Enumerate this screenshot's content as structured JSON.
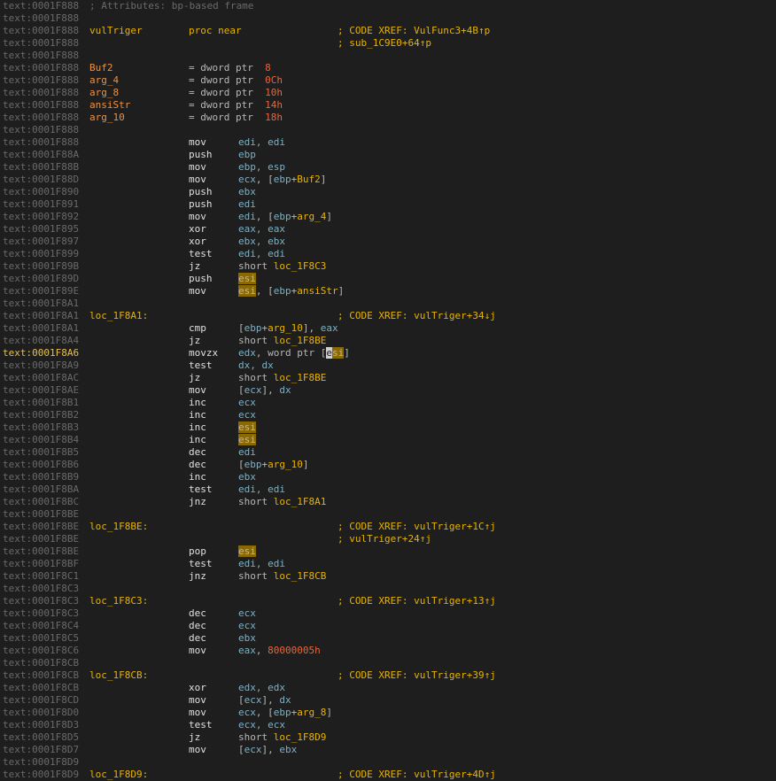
{
  "header_comment": "; Attributes: bp-based frame",
  "proc": {
    "name": "vulTriger",
    "decl": "proc near",
    "xrefs": [
      "; CODE XREF: VulFunc3+4B↑p",
      "; sub_1C9E0+64↑p"
    ]
  },
  "vars": [
    {
      "name": "Buf2",
      "def": "= dword ptr",
      "off": "8"
    },
    {
      "name": "arg_4",
      "def": "= dword ptr",
      "off": "0Ch"
    },
    {
      "name": "arg_8",
      "def": "= dword ptr",
      "off": "10h"
    },
    {
      "name": "ansiStr",
      "def": "= dword ptr",
      "off": "14h"
    },
    {
      "name": "arg_10",
      "def": "= dword ptr",
      "off": "18h"
    }
  ],
  "addresses": [
    "text:0001F888",
    "text:0001F888",
    "text:0001F888",
    "text:0001F888",
    "text:0001F888",
    "text:0001F888",
    "text:0001F888",
    "text:0001F888",
    "text:0001F888",
    "text:0001F888",
    "text:0001F888",
    "text:0001F888",
    "text:0001F88A",
    "text:0001F88B",
    "text:0001F88D",
    "text:0001F890",
    "text:0001F891",
    "text:0001F892",
    "text:0001F895",
    "text:0001F897",
    "text:0001F899",
    "text:0001F89B",
    "text:0001F89D",
    "text:0001F89E",
    "text:0001F8A1",
    "text:0001F8A1",
    "text:0001F8A1",
    "text:0001F8A4",
    "text:0001F8A6",
    "text:0001F8A9",
    "text:0001F8AC",
    "text:0001F8AE",
    "text:0001F8B1",
    "text:0001F8B2",
    "text:0001F8B3",
    "text:0001F8B4",
    "text:0001F8B5",
    "text:0001F8B6",
    "text:0001F8B9",
    "text:0001F8BA",
    "text:0001F8BC",
    "text:0001F8BE",
    "text:0001F8BE",
    "text:0001F8BE",
    "text:0001F8BE",
    "text:0001F8BF",
    "text:0001F8C1",
    "text:0001F8C3",
    "text:0001F8C3",
    "text:0001F8C3",
    "text:0001F8C4",
    "text:0001F8C5",
    "text:0001F8C6",
    "text:0001F8CB",
    "text:0001F8CB",
    "text:0001F8CB",
    "text:0001F8CD",
    "text:0001F8D0",
    "text:0001F8D3",
    "text:0001F8D5",
    "text:0001F8D7",
    "text:0001F8D9",
    "text:0001F8D9"
  ],
  "labels": {
    "loc_1F8A1": {
      "name": "loc_1F8A1:",
      "xref": "; CODE XREF: vulTriger+34↓j"
    },
    "loc_1F8BE": {
      "name": "loc_1F8BE:",
      "xref": "; CODE XREF: vulTriger+1C↑j",
      "xref2": "; vulTriger+24↑j"
    },
    "loc_1F8C3": {
      "name": "loc_1F8C3:",
      "xref": "; CODE XREF: vulTriger+13↑j"
    },
    "loc_1F8CB": {
      "name": "loc_1F8CB:",
      "xref": "; CODE XREF: vulTriger+39↑j"
    },
    "loc_1F8D9": {
      "name": "loc_1F8D9:",
      "xref": "; CODE XREF: vulTriger+4D↑j"
    }
  },
  "instructions": [
    {
      "m": "mov",
      "o": "edi, edi"
    },
    {
      "m": "push",
      "o": "ebp"
    },
    {
      "m": "mov",
      "o": "ebp, esp"
    },
    {
      "m": "mov",
      "o": "ecx, [ebp+Buf2]"
    },
    {
      "m": "push",
      "o": "ebx"
    },
    {
      "m": "push",
      "o": "edi"
    },
    {
      "m": "mov",
      "o": "edi, [ebp+arg_4]"
    },
    {
      "m": "xor",
      "o": "eax, eax"
    },
    {
      "m": "xor",
      "o": "ebx, ebx"
    },
    {
      "m": "test",
      "o": "edi, edi"
    },
    {
      "m": "jz",
      "o": "short loc_1F8C3"
    },
    {
      "m": "push",
      "o": "esi"
    },
    {
      "m": "mov",
      "o": "esi, [ebp+ansiStr]"
    },
    {
      "m": "cmp",
      "o": "[ebp+arg_10], eax"
    },
    {
      "m": "jz",
      "o": "short loc_1F8BE"
    },
    {
      "m": "movzx",
      "o": "edx, word ptr [esi]"
    },
    {
      "m": "test",
      "o": "dx, dx"
    },
    {
      "m": "jz",
      "o": "short loc_1F8BE"
    },
    {
      "m": "mov",
      "o": "[ecx], dx"
    },
    {
      "m": "inc",
      "o": "ecx"
    },
    {
      "m": "inc",
      "o": "ecx"
    },
    {
      "m": "inc",
      "o": "esi"
    },
    {
      "m": "inc",
      "o": "esi"
    },
    {
      "m": "dec",
      "o": "edi"
    },
    {
      "m": "dec",
      "o": "[ebp+arg_10]"
    },
    {
      "m": "inc",
      "o": "ebx"
    },
    {
      "m": "test",
      "o": "edi, edi"
    },
    {
      "m": "jnz",
      "o": "short loc_1F8A1"
    },
    {
      "m": "pop",
      "o": "esi"
    },
    {
      "m": "test",
      "o": "edi, edi"
    },
    {
      "m": "jnz",
      "o": "short loc_1F8CB"
    },
    {
      "m": "dec",
      "o": "ecx"
    },
    {
      "m": "dec",
      "o": "ecx"
    },
    {
      "m": "dec",
      "o": "ebx"
    },
    {
      "m": "mov",
      "o": "eax, 80000005h"
    },
    {
      "m": "xor",
      "o": "edx, edx"
    },
    {
      "m": "mov",
      "o": "[ecx], dx"
    },
    {
      "m": "mov",
      "o": "ecx, [ebp+arg_8]"
    },
    {
      "m": "test",
      "o": "ecx, ecx"
    },
    {
      "m": "jz",
      "o": "short loc_1F8D9"
    },
    {
      "m": "mov",
      "o": "[ecx], ebx"
    }
  ],
  "colors": {
    "background": "#1e1e1e",
    "address": "#6a6a6a",
    "label": "#e8b300",
    "register": "#7eb1c4",
    "number": "#e6673c",
    "highlight": "#8a6a00"
  }
}
